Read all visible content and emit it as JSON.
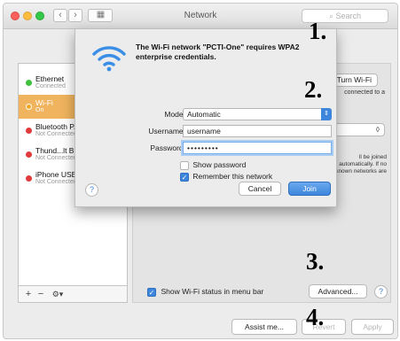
{
  "window": {
    "title": "Network",
    "search_placeholder": "Search"
  },
  "services": [
    {
      "name": "Ethernet",
      "status": "Connected",
      "color": "#3ec23e"
    },
    {
      "name": "Wi-Fi",
      "status": "On",
      "color": "#f5a623"
    },
    {
      "name": "Bluetooth PAN",
      "status": "Not Connected",
      "color": "#e03a3a"
    },
    {
      "name": "Thund...lt Bridge",
      "status": "Not Connected",
      "color": "#e03a3a"
    },
    {
      "name": "iPhone USB",
      "status": "Not Connected",
      "color": "#e03a3a"
    }
  ],
  "pane": {
    "turn_off_label": "Turn Wi-Fi Off",
    "connected_text": "connected to a",
    "auto_join_text": "ll be joined automatically. If no known networks are available, you will have",
    "show_status_label": "Show Wi-Fi status in menu bar",
    "advanced_label": "Advanced...",
    "help": "?"
  },
  "sidebar_tools": {
    "add": "+",
    "remove": "−",
    "gear": "⚙▾"
  },
  "bottom": {
    "assist_label": "Assist me...",
    "revert_label": "Revert",
    "apply_label": "Apply"
  },
  "sheet": {
    "message": "The Wi-Fi network \"PCTI-One\" requires WPA2 enterprise credentials.",
    "mode_label": "Mode:",
    "mode_value": "Automatic",
    "username_label": "Username:",
    "username_value": "username",
    "password_label": "Password:",
    "password_value": "•••••••••",
    "show_password_label": "Show password",
    "show_password_checked": false,
    "remember_label": "Remember this network",
    "remember_checked": true,
    "help": "?",
    "cancel_label": "Cancel",
    "join_label": "Join"
  },
  "annotations": [
    "1.",
    "2.",
    "3.",
    "4."
  ],
  "colors": {
    "accent": "#3d86dc",
    "selected_row": "#f0b45e"
  }
}
